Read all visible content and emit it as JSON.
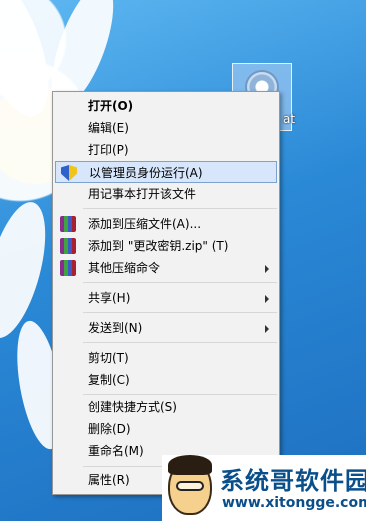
{
  "desktop": {
    "file": {
      "label": "at"
    }
  },
  "menu": {
    "items": [
      {
        "label": "打开(O)",
        "icon": "",
        "bold": true,
        "submenu": false
      },
      {
        "label": "编辑(E)",
        "icon": "",
        "bold": false,
        "submenu": false
      },
      {
        "label": "打印(P)",
        "icon": "",
        "bold": false,
        "submenu": false
      },
      {
        "label": "以管理员身份运行(A)",
        "icon": "shield-icon",
        "bold": false,
        "submenu": false,
        "highlighted": true
      },
      {
        "label": "用记事本打开该文件",
        "icon": "",
        "bold": false,
        "submenu": false
      },
      {
        "label": "添加到压缩文件(A)...",
        "icon": "winrar-icon",
        "bold": false,
        "submenu": false
      },
      {
        "label": "添加到 \"更改密钥.zip\" (T)",
        "icon": "winrar-icon",
        "bold": false,
        "submenu": false
      },
      {
        "label": "其他压缩命令",
        "icon": "winrar-icon",
        "bold": false,
        "submenu": true
      },
      {
        "label": "共享(H)",
        "icon": "",
        "bold": false,
        "submenu": true
      },
      {
        "label": "发送到(N)",
        "icon": "",
        "bold": false,
        "submenu": true
      },
      {
        "label": "剪切(T)",
        "icon": "",
        "bold": false,
        "submenu": false
      },
      {
        "label": "复制(C)",
        "icon": "",
        "bold": false,
        "submenu": false
      },
      {
        "label": "创建快捷方式(S)",
        "icon": "",
        "bold": false,
        "submenu": false
      },
      {
        "label": "删除(D)",
        "icon": "",
        "bold": false,
        "submenu": false
      },
      {
        "label": "重命名(M)",
        "icon": "",
        "bold": false,
        "submenu": false
      },
      {
        "label": "属性(R)",
        "icon": "",
        "bold": false,
        "submenu": false
      }
    ]
  },
  "watermark": {
    "title": "系统哥软件园",
    "url": "www.xitongge.com"
  },
  "colors": {
    "menu_bg": "#f2f2f2",
    "highlight_bg": "#d7e6fb",
    "highlight_border": "#7da2ce",
    "watermark_text": "#0b4f8a"
  }
}
